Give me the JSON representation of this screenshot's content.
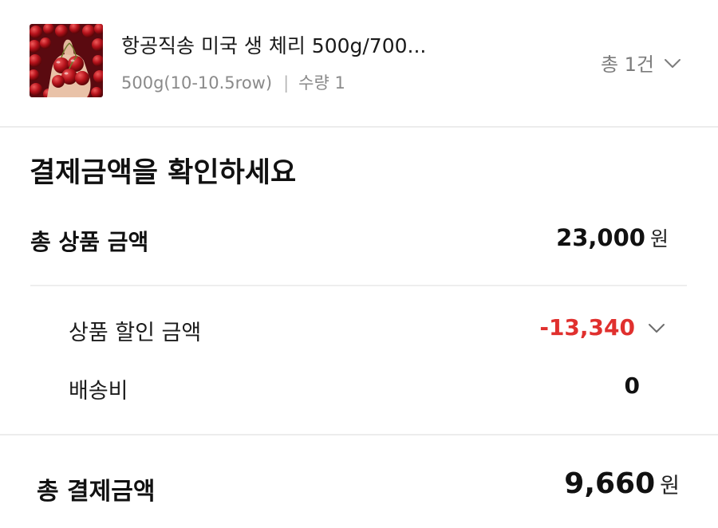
{
  "product": {
    "image_alt": "cherries in hand",
    "name": "항공직송 미국 생 체리 500g/700...",
    "option": "500g(10-10.5row)",
    "separator": "|",
    "quantity": "수량 1",
    "total_count": "총 1건",
    "expand_icon": "chevron-down-icon"
  },
  "summary": {
    "title": "결제금액을 확인하세요",
    "subtotal_label": "총 상품 금액",
    "subtotal_value": "23,000",
    "subtotal_unit": "원",
    "discount_label": "상품 할인 금액",
    "discount_value": "-13,340",
    "discount_icon": "chevron-down-icon",
    "shipping_label": "배송비",
    "shipping_value": "0",
    "total_label": "총 결제금액",
    "total_value": "9,660",
    "total_unit": "원"
  },
  "colors": {
    "discount": "#e0302e",
    "muted": "#8a8a8a",
    "divider": "#ececec"
  }
}
